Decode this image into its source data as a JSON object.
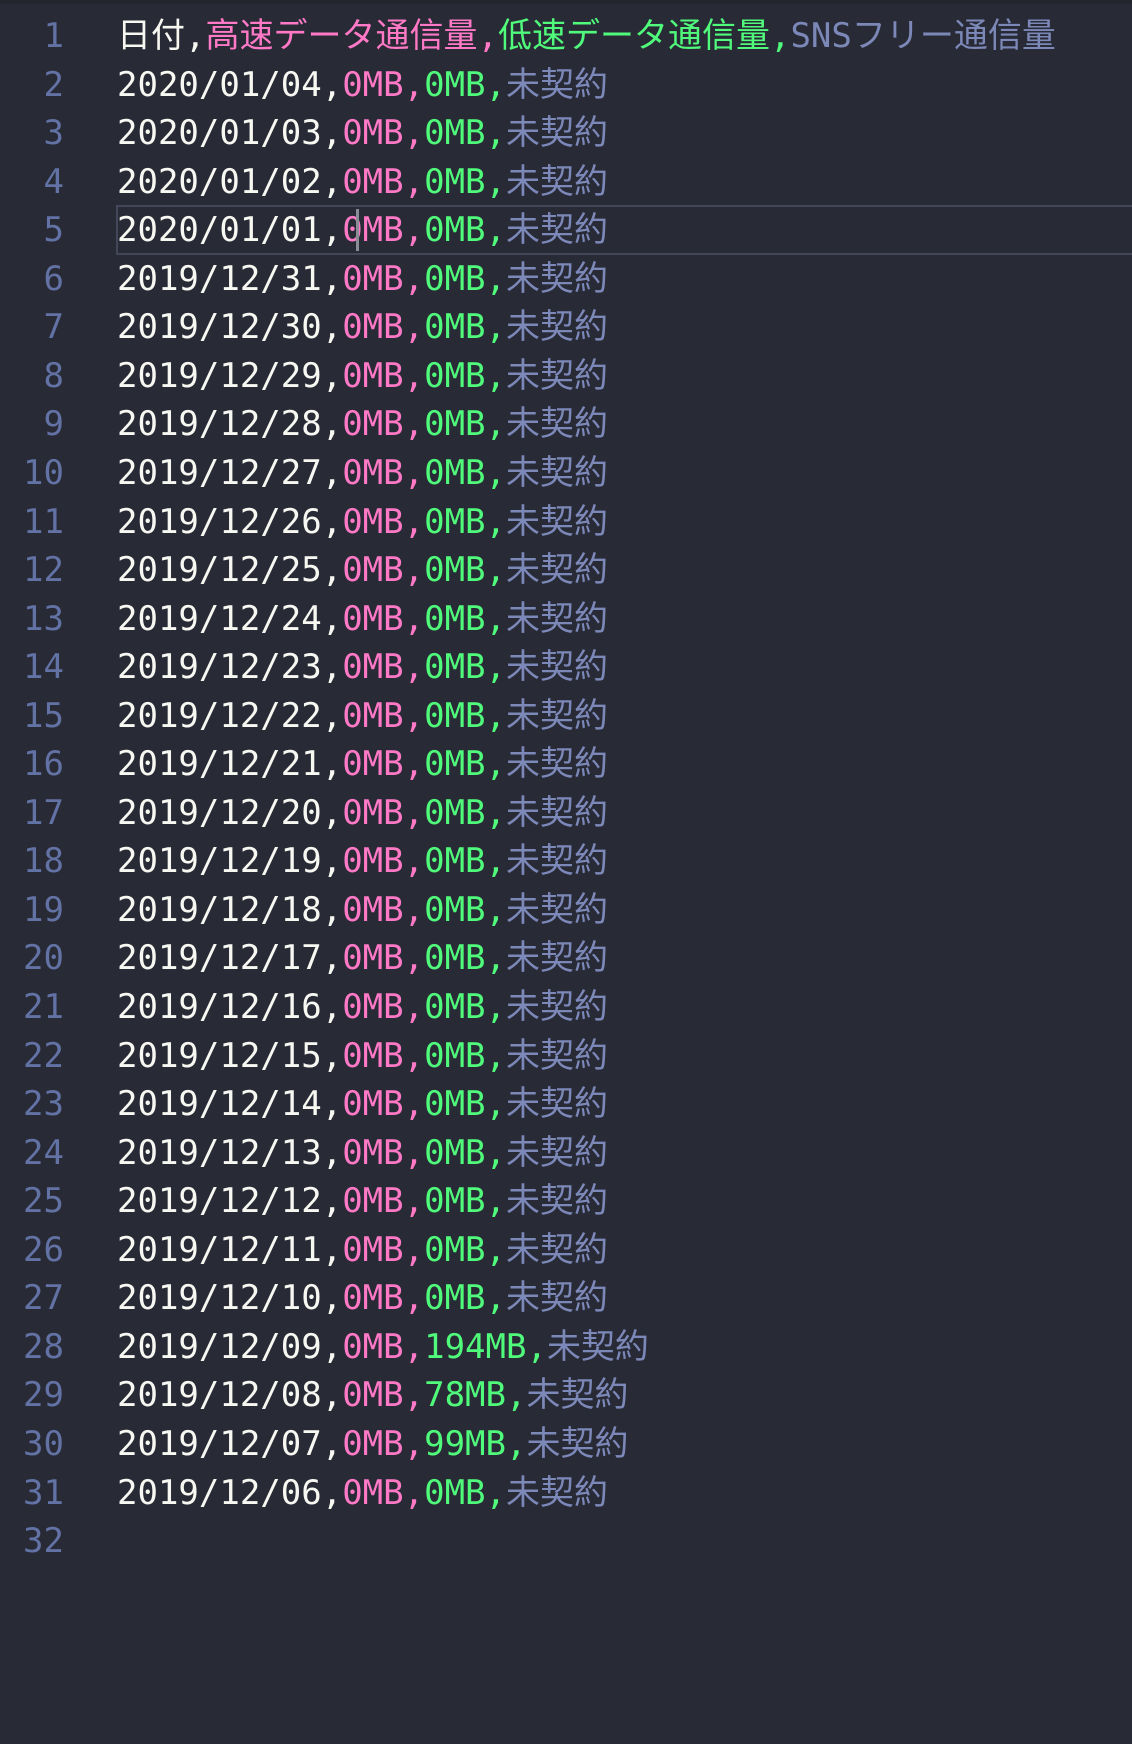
{
  "editor": {
    "lines": [
      {
        "num": "1",
        "f1": "日付",
        "f2": "高速データ通信量",
        "f3": "低速データ通信量",
        "f4": "SNSフリー通信量"
      },
      {
        "num": "2",
        "f1": "2020/01/04",
        "f2": "0MB",
        "f3": "0MB",
        "f4": "未契約"
      },
      {
        "num": "3",
        "f1": "2020/01/03",
        "f2": "0MB",
        "f3": "0MB",
        "f4": "未契約"
      },
      {
        "num": "4",
        "f1": "2020/01/02",
        "f2": "0MB",
        "f3": "0MB",
        "f4": "未契約"
      },
      {
        "num": "5",
        "f1": "2020/01/01",
        "f2": "0MB",
        "f3": "0MB",
        "f4": "未契約"
      },
      {
        "num": "6",
        "f1": "2019/12/31",
        "f2": "0MB",
        "f3": "0MB",
        "f4": "未契約"
      },
      {
        "num": "7",
        "f1": "2019/12/30",
        "f2": "0MB",
        "f3": "0MB",
        "f4": "未契約"
      },
      {
        "num": "8",
        "f1": "2019/12/29",
        "f2": "0MB",
        "f3": "0MB",
        "f4": "未契約"
      },
      {
        "num": "9",
        "f1": "2019/12/28",
        "f2": "0MB",
        "f3": "0MB",
        "f4": "未契約"
      },
      {
        "num": "10",
        "f1": "2019/12/27",
        "f2": "0MB",
        "f3": "0MB",
        "f4": "未契約"
      },
      {
        "num": "11",
        "f1": "2019/12/26",
        "f2": "0MB",
        "f3": "0MB",
        "f4": "未契約"
      },
      {
        "num": "12",
        "f1": "2019/12/25",
        "f2": "0MB",
        "f3": "0MB",
        "f4": "未契約"
      },
      {
        "num": "13",
        "f1": "2019/12/24",
        "f2": "0MB",
        "f3": "0MB",
        "f4": "未契約"
      },
      {
        "num": "14",
        "f1": "2019/12/23",
        "f2": "0MB",
        "f3": "0MB",
        "f4": "未契約"
      },
      {
        "num": "15",
        "f1": "2019/12/22",
        "f2": "0MB",
        "f3": "0MB",
        "f4": "未契約"
      },
      {
        "num": "16",
        "f1": "2019/12/21",
        "f2": "0MB",
        "f3": "0MB",
        "f4": "未契約"
      },
      {
        "num": "17",
        "f1": "2019/12/20",
        "f2": "0MB",
        "f3": "0MB",
        "f4": "未契約"
      },
      {
        "num": "18",
        "f1": "2019/12/19",
        "f2": "0MB",
        "f3": "0MB",
        "f4": "未契約"
      },
      {
        "num": "19",
        "f1": "2019/12/18",
        "f2": "0MB",
        "f3": "0MB",
        "f4": "未契約"
      },
      {
        "num": "20",
        "f1": "2019/12/17",
        "f2": "0MB",
        "f3": "0MB",
        "f4": "未契約"
      },
      {
        "num": "21",
        "f1": "2019/12/16",
        "f2": "0MB",
        "f3": "0MB",
        "f4": "未契約"
      },
      {
        "num": "22",
        "f1": "2019/12/15",
        "f2": "0MB",
        "f3": "0MB",
        "f4": "未契約"
      },
      {
        "num": "23",
        "f1": "2019/12/14",
        "f2": "0MB",
        "f3": "0MB",
        "f4": "未契約"
      },
      {
        "num": "24",
        "f1": "2019/12/13",
        "f2": "0MB",
        "f3": "0MB",
        "f4": "未契約"
      },
      {
        "num": "25",
        "f1": "2019/12/12",
        "f2": "0MB",
        "f3": "0MB",
        "f4": "未契約"
      },
      {
        "num": "26",
        "f1": "2019/12/11",
        "f2": "0MB",
        "f3": "0MB",
        "f4": "未契約"
      },
      {
        "num": "27",
        "f1": "2019/12/10",
        "f2": "0MB",
        "f3": "0MB",
        "f4": "未契約"
      },
      {
        "num": "28",
        "f1": "2019/12/09",
        "f2": "0MB",
        "f3": "194MB",
        "f4": "未契約"
      },
      {
        "num": "29",
        "f1": "2019/12/08",
        "f2": "0MB",
        "f3": "78MB",
        "f4": "未契約"
      },
      {
        "num": "30",
        "f1": "2019/12/07",
        "f2": "0MB",
        "f3": "99MB",
        "f4": "未契約"
      },
      {
        "num": "31",
        "f1": "2019/12/06",
        "f2": "0MB",
        "f3": "0MB",
        "f4": "未契約"
      },
      {
        "num": "32",
        "f1": "",
        "f2": "",
        "f3": "",
        "f4": ""
      }
    ],
    "separator": ",",
    "colors": {
      "background": "#282a36",
      "line_number": "#6272a4",
      "field1": "#f8f8f2",
      "field2": "#ff79c6",
      "field3": "#50fa7b",
      "field4": "#7c88b8"
    }
  }
}
